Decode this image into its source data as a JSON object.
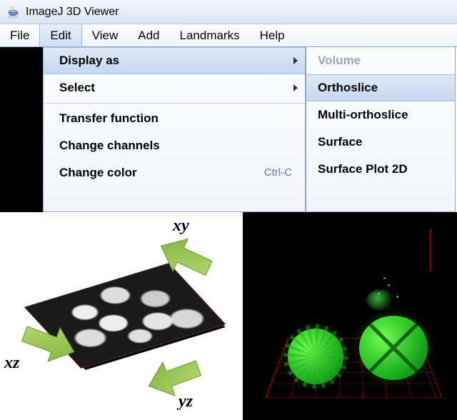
{
  "window": {
    "title": "ImageJ 3D Viewer"
  },
  "menubar": {
    "items": [
      {
        "label": "File"
      },
      {
        "label": "Edit",
        "open": true
      },
      {
        "label": "View"
      },
      {
        "label": "Add"
      },
      {
        "label": "Landmarks"
      },
      {
        "label": "Help"
      }
    ]
  },
  "edit_menu": {
    "items": [
      {
        "label": "Display as",
        "has_submenu": true,
        "hovered": true
      },
      {
        "label": "Select",
        "has_submenu": true
      },
      {
        "label": "Transfer function"
      },
      {
        "label": "Change channels"
      },
      {
        "label": "Change color",
        "shortcut": "Ctrl-C"
      }
    ]
  },
  "display_as_submenu": {
    "items": [
      {
        "label": "Volume",
        "disabled": true
      },
      {
        "label": "Orthoslice",
        "hovered": true
      },
      {
        "label": "Multi-orthoslice"
      },
      {
        "label": "Surface"
      },
      {
        "label": "Surface Plot 2D"
      }
    ]
  },
  "orthoslice_labels": {
    "xy": "xy",
    "xz": "xz",
    "yz": "yz"
  }
}
